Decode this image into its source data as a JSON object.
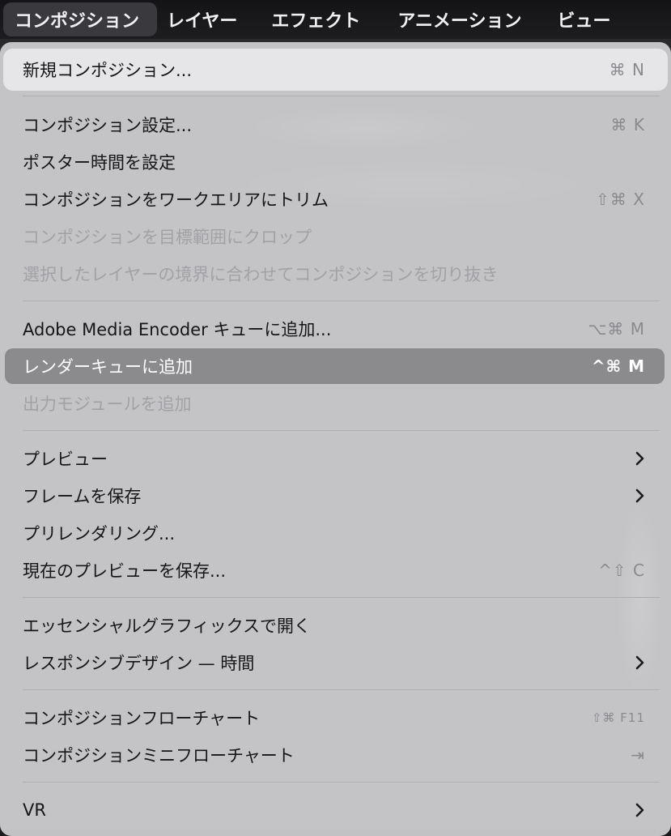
{
  "menubar": {
    "items": [
      {
        "label": "コンポジション"
      },
      {
        "label": "レイヤー"
      },
      {
        "label": "エフェクト"
      },
      {
        "label": "アニメーション"
      },
      {
        "label": "ビュー"
      }
    ]
  },
  "menu": {
    "items": [
      {
        "label": "新規コンポジション...",
        "shortcut": "⌘ N"
      },
      {
        "label": "コンポジション設定...",
        "shortcut": "⌘ K"
      },
      {
        "label": "ポスター時間を設定",
        "shortcut": ""
      },
      {
        "label": "コンポジションをワークエリアにトリム",
        "shortcut": "⇧⌘ X"
      },
      {
        "label": "コンポジションを目標範囲にクロップ",
        "shortcut": ""
      },
      {
        "label": "選択したレイヤーの境界に合わせてコンポジションを切り抜き",
        "shortcut": ""
      },
      {
        "label": "Adobe Media Encoder キューに追加...",
        "shortcut": "⌥⌘ M"
      },
      {
        "label": "レンダーキューに追加",
        "shortcut": "^⌘ M"
      },
      {
        "label": "出力モジュールを追加",
        "shortcut": ""
      },
      {
        "label": "プレビュー",
        "shortcut": ""
      },
      {
        "label": "フレームを保存",
        "shortcut": ""
      },
      {
        "label": "プリレンダリング...",
        "shortcut": ""
      },
      {
        "label": "現在のプレビューを保存...",
        "shortcut": "^⇧ C"
      },
      {
        "label": "エッセンシャルグラフィックスで開く",
        "shortcut": ""
      },
      {
        "label": "レスポンシブデザイン — 時間",
        "shortcut": ""
      },
      {
        "label": "コンポジションフローチャート",
        "shortcut": "⇧⌘ F11"
      },
      {
        "label": "コンポジションミニフローチャート",
        "shortcut": "⇥"
      },
      {
        "label": "VR",
        "shortcut": ""
      }
    ]
  },
  "colors": {
    "menu_bg": "#d0d0d2",
    "highlight": "#8b8b8e",
    "disabled_text": "#a2a2a6",
    "menubar_bg": "#1a1a1c"
  }
}
